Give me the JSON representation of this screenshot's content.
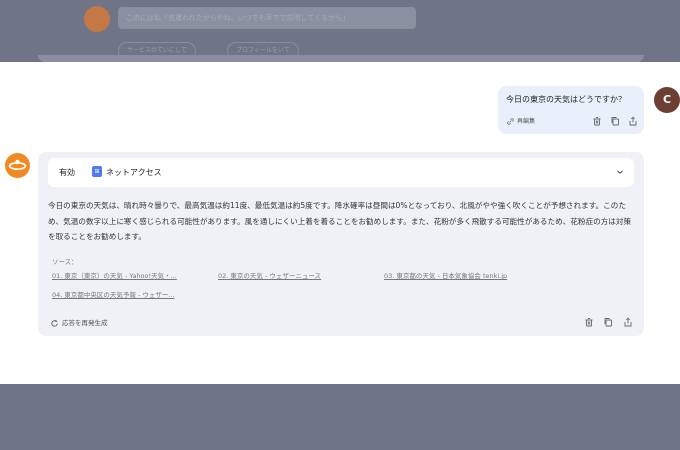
{
  "previous_chat": {
    "prompt": "このには私「気遣われたからやね、いつでも手でで説明してくるから」",
    "suggestion_1": "サービスのていにして",
    "suggestion_2": "プロフィールをいて"
  },
  "user_message": {
    "text": "今日の東京の天気はどうですか？",
    "edit_label": "再編集",
    "avatar_initial": "C"
  },
  "assistant": {
    "access_label": "有効",
    "access_status": "ネットアクセス",
    "answer": "今日の東京の天気は、晴れ時々曇りで、最高気温は約11度、最低気温は約5度です。降水確率は昼間は0%となっており、北風がやや強く吹くことが予想されます。このため、気温の数字以上に寒く感じられる可能性があります。風を通しにくい上着を着ることをお勧めします。また、花粉が多く飛散する可能性があるため、花粉症の方は対策を取ることをお勧めします。",
    "sources_title": "ソース：",
    "sources": [
      "01. 東京（東京）の天気 - Yahoo!天気・...",
      "02. 東京の天気 - ウェザーニュース",
      "03. 東京都の天気 - 日本気象協会 tenki.jp",
      "04. 東京都中央区の天気予報 - ウェザー..."
    ],
    "regenerate_label": "応答を再発生成"
  },
  "colors": {
    "overlay": "#6f7487",
    "user_bubble": "#eaf0fb",
    "bot_card": "#eff1f7",
    "accent_blue": "#4c7bf2",
    "bot_avatar": "#f08a24",
    "user_avatar": "#6b3f33"
  }
}
